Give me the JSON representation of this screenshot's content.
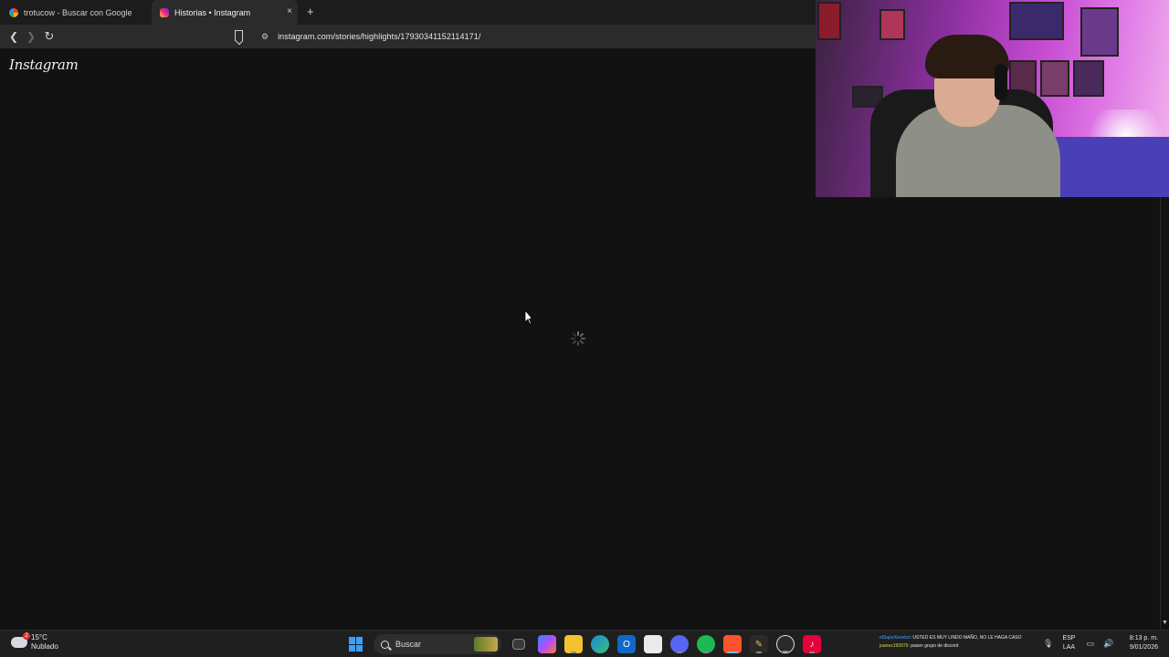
{
  "browser": {
    "tabs": [
      {
        "title": "trotucow - Buscar con Google",
        "icon": "google-icon",
        "active": false
      },
      {
        "title": "Historias • Instagram",
        "icon": "instagram-icon",
        "active": true
      }
    ],
    "new_tab_label": "+",
    "tab_close_label": "×",
    "url": "instagram.com/stories/highlights/17930341152114171/"
  },
  "page": {
    "logo_text": "Instagram",
    "state": "loading"
  },
  "taskbar": {
    "weather": {
      "temp": "15°C",
      "condition": "Nublado",
      "badge": "2"
    },
    "search_placeholder": "Buscar",
    "apps": [
      "windows-start-icon",
      "search-box",
      "task-view-icon",
      "copilot-icon",
      "file-explorer-icon",
      "edge-icon",
      "outlook-icon",
      "store-icon",
      "discord-icon",
      "spotify-icon",
      "brave-icon",
      "app-icon",
      "obs-icon",
      "tiktok-icon"
    ],
    "chat": [
      {
        "user": "elSapoXenelze",
        "message": ": USTED ES MUY LINDO MAÑO, NO LE HAGA CASO"
      },
      {
        "user": "juanes190975",
        "message": ": pasen grupo de discord"
      }
    ],
    "language": {
      "top": "ESP",
      "bottom": "LAA"
    },
    "clock": {
      "time": "8:13 p. m.",
      "date": "9/01/2026"
    }
  },
  "colors": {
    "page_bg": "#121212",
    "tab_strip_bg": "#1c1c1c",
    "toolbar_bg": "#2b2b2b",
    "taskbar_bg": "#1f1f1f",
    "accent": "#3aa0ff"
  }
}
